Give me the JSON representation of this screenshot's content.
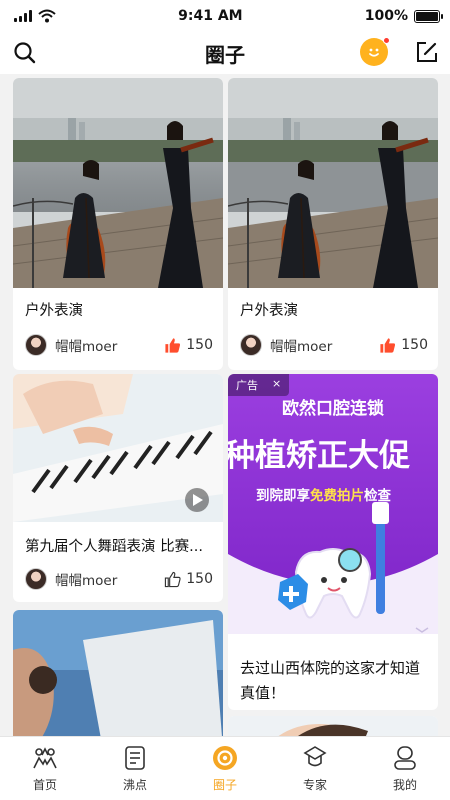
{
  "status": {
    "time": "9:41 AM",
    "battery_text": "100%",
    "battery_level": 1.0
  },
  "header": {
    "title": "圈子"
  },
  "colors": {
    "accent": "#f5a623",
    "like_red": "#ff4d2d",
    "ad_purple": "#8b2fd6"
  },
  "posts": [
    {
      "title": "户外表演",
      "author": "帽帽moer",
      "likes": "150",
      "liked": true
    },
    {
      "title": "户外表演",
      "author": "帽帽moer",
      "likes": "150",
      "liked": true
    },
    {
      "title": "第九届个人舞蹈表演 比赛...",
      "author": "帽帽moer",
      "likes": "150",
      "liked": false
    }
  ],
  "ad": {
    "tag": "广告",
    "close": "×",
    "brand": "欧然口腔连锁",
    "headline": "种植矫正大促",
    "offer_prefix": "到院即享",
    "offer_highlight": "免费拍片",
    "offer_suffix": "检查",
    "caption": "去过山西体院的这家才知道真值！"
  },
  "tabs": [
    {
      "label": "首页",
      "icon": "home-people-icon",
      "active": false
    },
    {
      "label": "沸点",
      "icon": "list-doc-icon",
      "active": false
    },
    {
      "label": "圈子",
      "icon": "circle-icon",
      "active": true
    },
    {
      "label": "专家",
      "icon": "expert-icon",
      "active": false
    },
    {
      "label": "我的",
      "icon": "profile-icon",
      "active": false
    }
  ]
}
